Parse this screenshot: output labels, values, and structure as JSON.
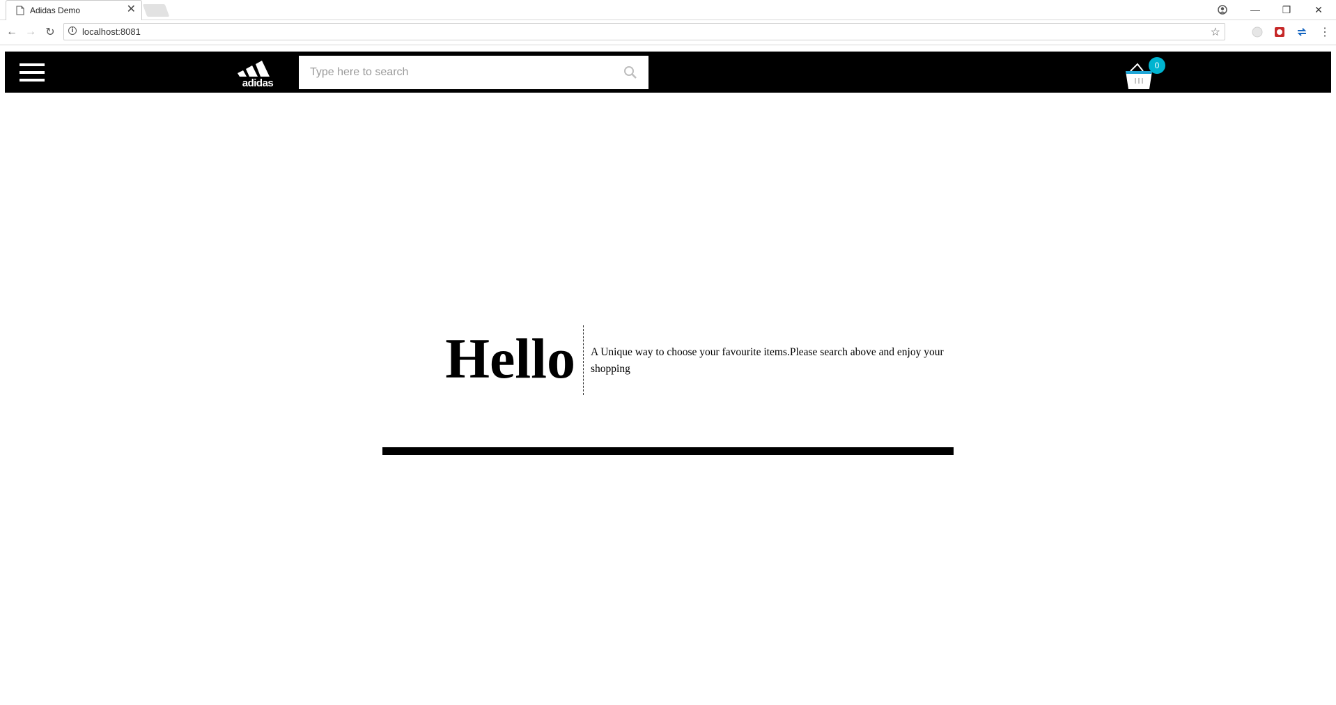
{
  "browser": {
    "tab_title": "Adidas Demo",
    "tab_close": "✕",
    "url": "localhost:8081",
    "nav": {
      "back": "←",
      "forward": "→",
      "reload": "↻"
    },
    "window_controls": {
      "minimize": "—",
      "restore": "❐",
      "close": "✕"
    },
    "icons": [
      "page-icon",
      "account-icon",
      "star-icon",
      "info-icon"
    ]
  },
  "header": {
    "logo_text": "adidas",
    "search": {
      "placeholder": "Type here to search",
      "value": ""
    },
    "cart": {
      "count": "0",
      "accent_color": "#00b4d0"
    },
    "background_color": "#000000"
  },
  "hero": {
    "title": "Hello",
    "tagline": "A Unique way to choose your favourite items.Please search above and enjoy your shopping"
  }
}
